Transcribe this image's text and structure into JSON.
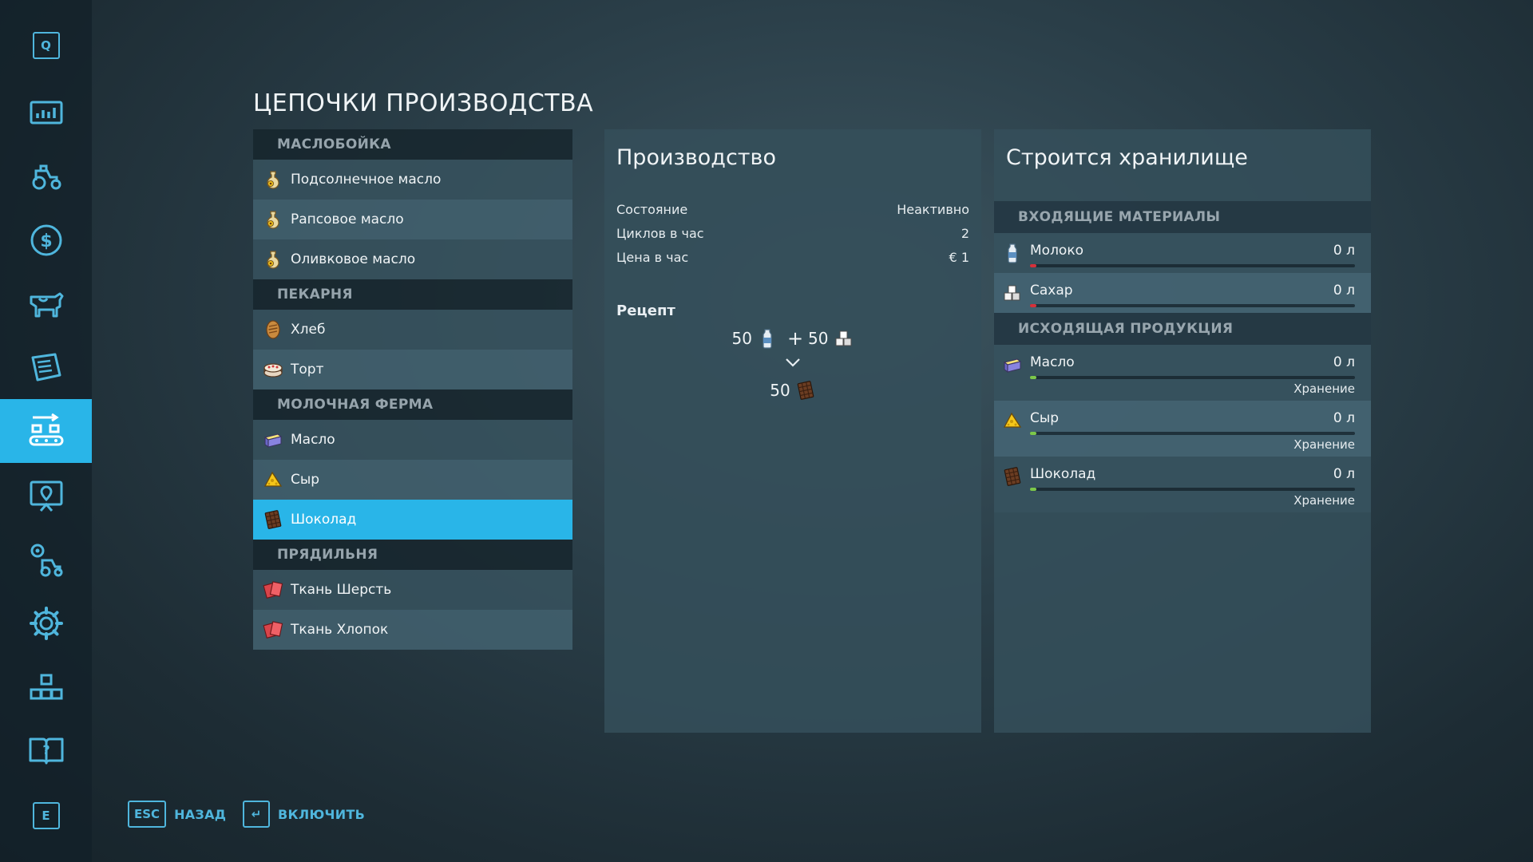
{
  "page_title": "ЦЕПОЧКИ ПРОИЗВОДСТВА",
  "sidebar": {
    "top_key": "Q",
    "bottom_key": "E",
    "items": [
      {
        "icon": "stats-icon"
      },
      {
        "icon": "tractor-icon"
      },
      {
        "icon": "finance-icon"
      },
      {
        "icon": "cow-icon"
      },
      {
        "icon": "contracts-icon"
      },
      {
        "icon": "production-chains-icon",
        "active": true
      },
      {
        "icon": "map-icon"
      },
      {
        "icon": "garage-icon"
      },
      {
        "icon": "settings-icon"
      },
      {
        "icon": "blocks-icon"
      },
      {
        "icon": "help-book-icon"
      }
    ]
  },
  "chains": {
    "group1": {
      "header": "МАСЛОБОЙКА",
      "items": [
        "Подсолнечное масло",
        "Рапсовое масло",
        "Оливковое масло"
      ]
    },
    "group2": {
      "header": "ПЕКАРНЯ",
      "items": [
        "Хлеб",
        "Торт"
      ]
    },
    "group3": {
      "header": "МОЛОЧНАЯ ФЕРМА",
      "items": [
        "Масло",
        "Сыр",
        "Шоколад"
      ],
      "selected": "Шоколад"
    },
    "group4": {
      "header": "ПРЯДИЛЬНЯ",
      "items": [
        "Ткань Шерсть",
        "Ткань Хлопок"
      ]
    }
  },
  "production": {
    "title": "Производство",
    "stats": [
      {
        "label": "Состояние",
        "value": "Неактивно"
      },
      {
        "label": "Циклов в час",
        "value": "2"
      },
      {
        "label": "Цена в час",
        "value": "€ 1"
      }
    ],
    "recipe_label": "Рецепт",
    "recipe": {
      "in1": "50",
      "plus": "+",
      "in2": "50",
      "out": "50"
    }
  },
  "storage": {
    "title": "Строится хранилище",
    "incoming_header": "ВХОДЯЩИЕ МАТЕРИАЛЫ",
    "incoming": [
      {
        "name": "Молоко",
        "value": "0 л",
        "bar_color": "#d6303a"
      },
      {
        "name": "Сахар",
        "value": "0 л",
        "bar_color": "#d6303a"
      }
    ],
    "outgoing_header": "ИСХОДЯЩАЯ ПРОДУКЦИЯ",
    "outgoing": [
      {
        "name": "Масло",
        "value": "0 л",
        "mode": "Хранение",
        "bar_color": "#7cc84a"
      },
      {
        "name": "Сыр",
        "value": "0 л",
        "mode": "Хранение",
        "bar_color": "#7cc84a"
      },
      {
        "name": "Шоколад",
        "value": "0 л",
        "mode": "Хранение",
        "bar_color": "#7cc84a"
      }
    ]
  },
  "footer": {
    "back_key": "ESC",
    "back_label": "НАЗАД",
    "enable_key": "↵",
    "enable_label": "ВКЛЮЧИТЬ"
  },
  "colors": {
    "accent": "#29b5e8",
    "key_blue": "#4fb6dd"
  }
}
